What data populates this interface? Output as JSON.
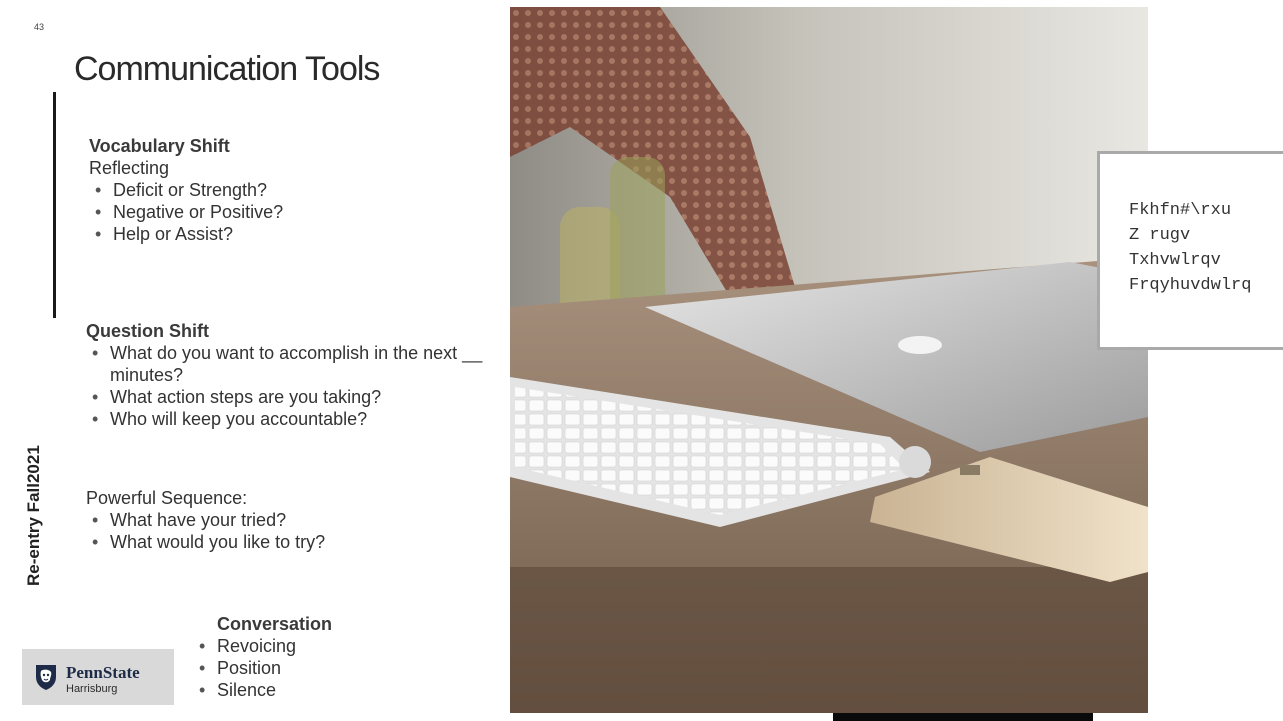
{
  "slide": {
    "page_number": "43",
    "title": "Communication Tools",
    "vertical_label": "Re-entry Fall2021"
  },
  "vocabulary": {
    "heading": "Vocabulary Shift",
    "subheading": "Reflecting",
    "items": [
      "Deficit or Strength?",
      "Negative or Positive?",
      "Help or Assist?"
    ]
  },
  "question": {
    "heading": "Question Shift",
    "items": [
      "What do you want to accomplish in the next __ minutes?",
      "What action steps are you taking?",
      "Who will keep you accountable?"
    ]
  },
  "sequence": {
    "heading": "Powerful Sequence:",
    "items": [
      "What have your tried?",
      "What would you like to try?"
    ]
  },
  "conversation": {
    "heading": "Conversation",
    "items": [
      "Revoicing",
      "Position",
      "Silence"
    ]
  },
  "logo": {
    "name": "PennState",
    "campus": "Harrisburg",
    "icon": "nittany-lion-shield-icon",
    "color": "#1e2b48"
  },
  "cipher_box": {
    "lines": [
      "Fkhfn#\\rxu",
      "Z rugv",
      "Txhvwlrqv",
      "Frqyhuvdwlrq"
    ]
  },
  "photo": {
    "icon": "desk-laptop-keyboard-photo"
  }
}
